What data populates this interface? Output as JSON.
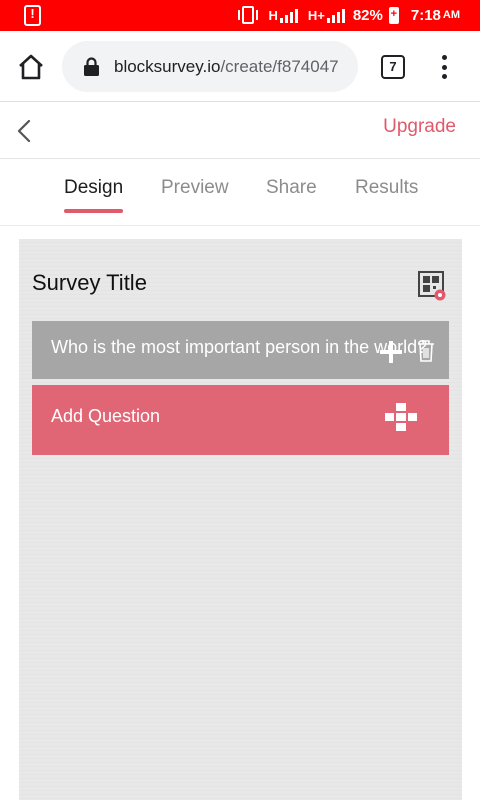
{
  "status_bar": {
    "network_1": "H",
    "network_2": "H+",
    "battery": "82%",
    "time": "7:18",
    "ampm": "AM"
  },
  "browser": {
    "url_domain": "blocksurvey.io",
    "url_path": "/create/f874047",
    "tab_count": "7"
  },
  "header": {
    "upgrade_label": "Upgrade"
  },
  "tabs": [
    {
      "label": "Design",
      "active": true
    },
    {
      "label": "Preview",
      "active": false
    },
    {
      "label": "Share",
      "active": false
    },
    {
      "label": "Results",
      "active": false
    }
  ],
  "survey": {
    "title": "Survey Title",
    "questions": [
      {
        "text": "Who is the most important person in the world?"
      }
    ],
    "add_question_label": "Add Question"
  },
  "colors": {
    "status_bar": "#ff0000",
    "accent": "#e05a6b",
    "question_card": "#a6a6a6",
    "add_card": "#e06575"
  },
  "icons": [
    "alert-icon",
    "vibrate-icon",
    "signal-icon",
    "battery-icon",
    "home-icon",
    "lock-icon",
    "tabs-icon",
    "more-vert-icon",
    "back-icon",
    "qr-code-settings-icon",
    "move-icon",
    "trash-icon",
    "add-icon"
  ]
}
